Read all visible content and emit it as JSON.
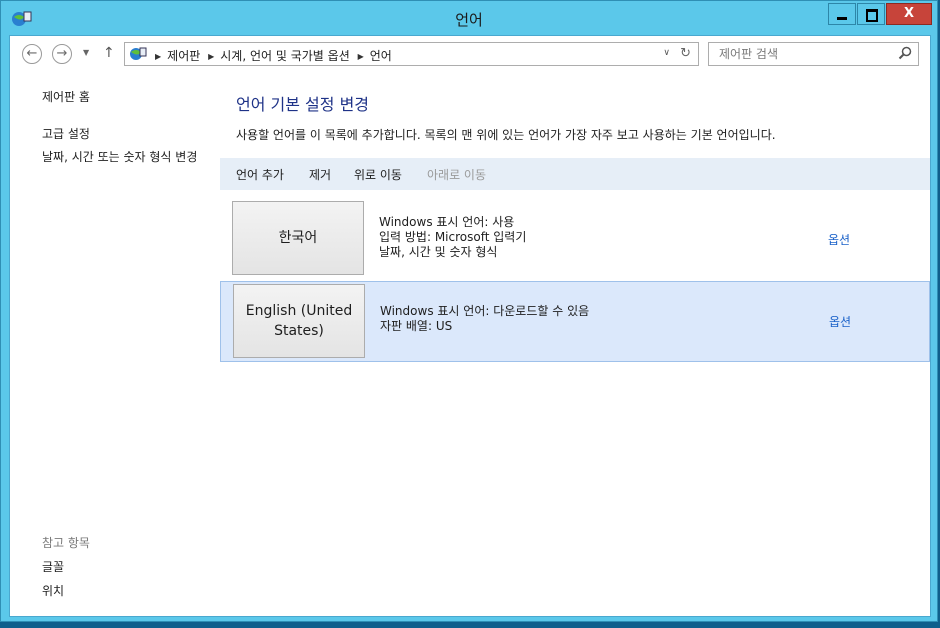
{
  "window": {
    "title": "언어",
    "close_glyph": "X"
  },
  "address": {
    "crumbs": [
      "제어판",
      "시계, 언어 및 국가별 옵션",
      "언어"
    ],
    "search_placeholder": "제어판 검색"
  },
  "left_pane": {
    "home": "제어판 홈",
    "advanced": "고급 설정",
    "datetime": "날짜, 시간 또는 숫자 형식 변경",
    "see_also_title": "참고 항목",
    "fonts": "글꼴",
    "location": "위치"
  },
  "main": {
    "heading": "언어 기본 설정 변경",
    "description": "사용할 언어를 이 목록에 추가합니다. 목록의 맨 위에 있는 언어가 가장 자주 보고 사용하는 기본 언어입니다.",
    "toolbar": {
      "add": "언어 추가",
      "remove": "제거",
      "move_up": "위로 이동",
      "move_down": "아래로 이동"
    },
    "languages": [
      {
        "name": "한국어",
        "details": [
          "Windows 표시 언어: 사용",
          "입력 방법: Microsoft 입력기",
          "날짜, 시간 및 숫자 형식"
        ],
        "options": "옵션"
      },
      {
        "name": "English (United States)",
        "details": [
          "Windows 표시 언어: 다운로드할 수 있음",
          "자판 배열: US"
        ],
        "options": "옵션"
      }
    ]
  },
  "colors": {
    "title_bar": "#5bc8ea",
    "link": "#1b62c9",
    "heading": "#1e3287",
    "selected_row": "#dbe8fb"
  },
  "icons": [
    "control-panel-icon",
    "back-arrow-icon",
    "forward-arrow-icon",
    "up-arrow-icon",
    "refresh-icon",
    "search-icon"
  ]
}
